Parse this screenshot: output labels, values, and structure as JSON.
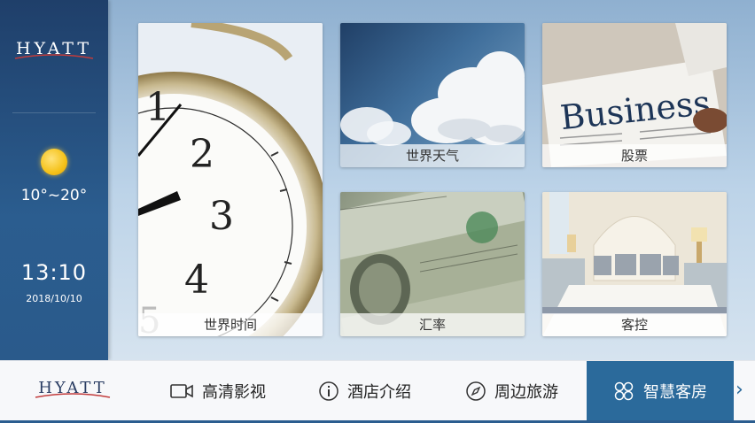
{
  "brand": {
    "logo_text": "HYATT"
  },
  "sidebar": {
    "temperature": "10°~20°",
    "time": "13:10",
    "date": "2018/10/10"
  },
  "tiles": {
    "clock": "世界时间",
    "weather": "世界天气",
    "stock": "股票",
    "exchange": "汇率",
    "room_control": "客控"
  },
  "stock_image_text": "Business",
  "bottom_nav": {
    "items": [
      {
        "label": "高清影视",
        "icon": "video-camera-icon"
      },
      {
        "label": "酒店介绍",
        "icon": "info-icon"
      },
      {
        "label": "周边旅游",
        "icon": "compass-icon"
      },
      {
        "label": "智慧客房",
        "icon": "smart-room-icon"
      }
    ],
    "next_icon": "chevron-right-icon"
  },
  "colors": {
    "sidebar": "#2b5d8f",
    "accent": "#2b6a9b",
    "sun": "#f5c21a"
  }
}
